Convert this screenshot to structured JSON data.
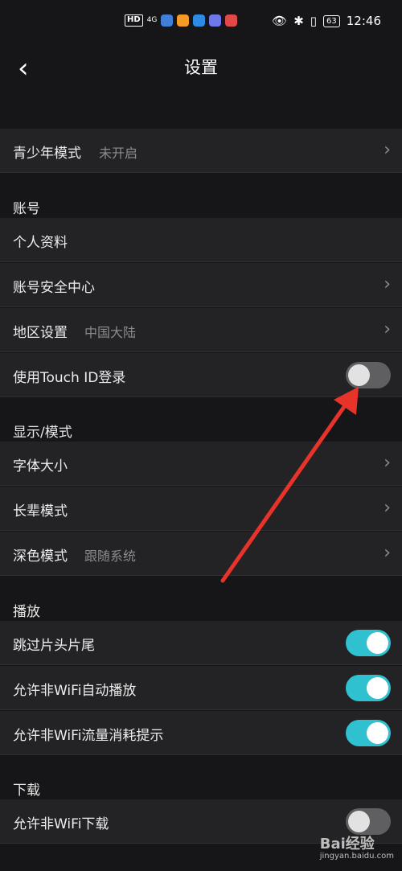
{
  "status_bar": {
    "time": "12:46",
    "battery": "63",
    "hd": "HD",
    "network": "4G"
  },
  "header": {
    "title": "设置",
    "back_glyph": "‹"
  },
  "teen": {
    "label": "青少年模式",
    "value": "未开启"
  },
  "sections": {
    "account": "账号",
    "display": "显示/模式",
    "play": "播放",
    "download": "下载"
  },
  "account_items": {
    "profile": "个人资料",
    "security": "账号安全中心",
    "region_label": "地区设置",
    "region_value": "中国大陆",
    "touch_id": "使用Touch ID登录"
  },
  "display_items": {
    "font_size": "字体大小",
    "elder": "长辈模式",
    "dark_label": "深色模式",
    "dark_value": "跟随系统"
  },
  "play_items": {
    "skip": "跳过片头片尾",
    "autoplay": "允许非WiFi自动播放",
    "data_tip": "允许非WiFi流量消耗提示"
  },
  "download_items": {
    "non_wifi": "允许非WiFi下载"
  },
  "toggles": {
    "touch_id": false,
    "skip": true,
    "autoplay": true,
    "data_tip": true,
    "download": false
  },
  "colors": {
    "toggle_on": "#2fc1d0",
    "toggle_off": "#5f5f61",
    "annotation_arrow": "#e8332a"
  },
  "watermark": {
    "brand": "Bai经验",
    "url": "jingyan.baidu.com"
  },
  "icons": [
    "back-chevron-icon",
    "chevron-right-icon",
    "eye-icon",
    "bluetooth-icon",
    "vibrate-icon",
    "battery-icon"
  ]
}
